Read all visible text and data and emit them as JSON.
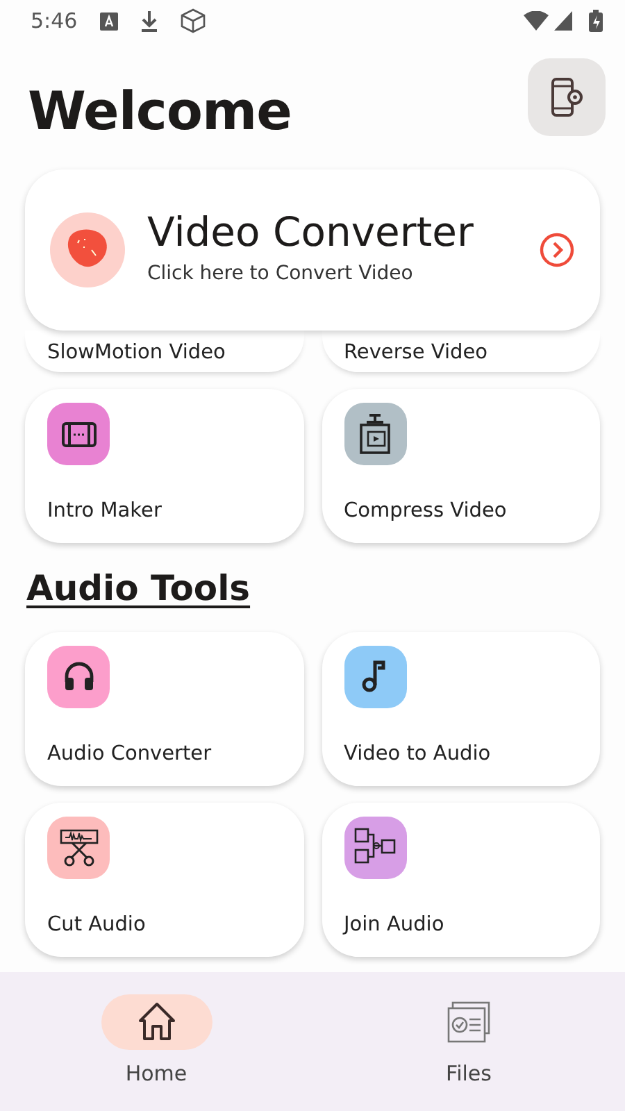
{
  "status_bar": {
    "time": "5:46"
  },
  "header": {
    "title": "Welcome"
  },
  "hero": {
    "title": "Video Converter",
    "subtitle": "Click here to Convert Video"
  },
  "video_tools": [
    {
      "label": "SlowMotion Video",
      "partial": true
    },
    {
      "label": "Reverse Video",
      "partial": true
    },
    {
      "label": "Intro Maker",
      "color": "#e882d2",
      "partial": false
    },
    {
      "label": "Compress Video",
      "color": "#b1bfc6",
      "partial": false
    }
  ],
  "audio_section": {
    "title": "Audio Tools"
  },
  "audio_tools": [
    {
      "label": "Audio Converter",
      "color": "#fc9ecb"
    },
    {
      "label": "Video to Audio",
      "color": "#8ecaf7"
    },
    {
      "label": "Cut Audio",
      "color": "#fdbcbc"
    },
    {
      "label": "Join Audio",
      "color": "#d79ee6"
    }
  ],
  "bottom_nav": [
    {
      "label": "Home",
      "selected": true
    },
    {
      "label": "Files",
      "selected": false
    }
  ]
}
